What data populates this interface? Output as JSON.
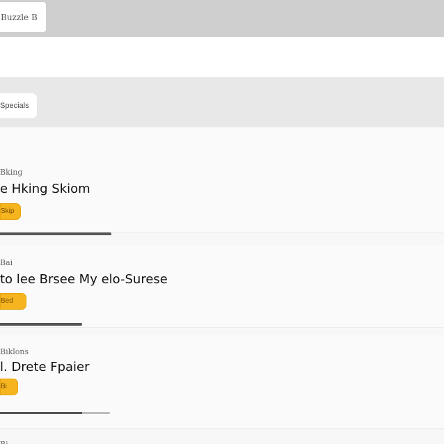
{
  "top_tab": {
    "label": "Buzzle B"
  },
  "sub_chip": {
    "label": "Specials"
  },
  "cards": [
    {
      "meta": "Bking",
      "title": "e Hking Skiom",
      "badge": "Skip"
    },
    {
      "meta": "Bai",
      "title": "to lee Brsee My elo-Surese",
      "badge": "Bed"
    },
    {
      "meta": "Biklons",
      "title": "l. Drete Fpaier",
      "badge": "Bi"
    }
  ],
  "trailing_meta": "Bi"
}
